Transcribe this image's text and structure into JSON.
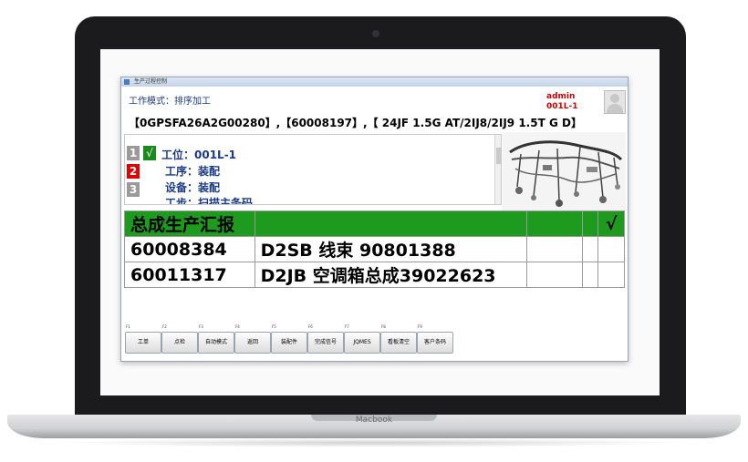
{
  "device": {
    "brand": "Macbook"
  },
  "window": {
    "title": "生产过程控制"
  },
  "header": {
    "mode": "工作模式：排序加工",
    "user": "admin",
    "station": "001L-1"
  },
  "order_line": "【0GPSFA26A2G00280】,【60008197】,【 24JF 1.5G AT/2IJ8/2IJ9 1.5T G D】",
  "steps": [
    {
      "num": "1",
      "color": "#9a9a9a"
    },
    {
      "num": "2",
      "color": "#e00000"
    },
    {
      "num": "3",
      "color": "#9a9a9a"
    }
  ],
  "check_mark": "√",
  "process": {
    "station_line": "工位：001L-1",
    "procedure_line": "工序：装配",
    "equipment_line": "设备：装配",
    "cut_line": "工步：扫描主条码"
  },
  "table": {
    "header": [
      "总成生产汇报",
      "",
      "",
      "",
      "√"
    ],
    "rows": [
      [
        "60008384",
        "D2SB 线束 90801388",
        "",
        "",
        ""
      ],
      [
        "60011317",
        "D2JB 空调箱总成39022623",
        "",
        "",
        ""
      ]
    ]
  },
  "fkeys": [
    {
      "key": "F1",
      "label": "工单"
    },
    {
      "key": "F2",
      "label": "点检"
    },
    {
      "key": "F3",
      "label": "自动模式"
    },
    {
      "key": "F4",
      "label": "返回"
    },
    {
      "key": "F5",
      "label": "装配件"
    },
    {
      "key": "F6",
      "label": "完成信号"
    },
    {
      "key": "F7",
      "label": "JQMES"
    },
    {
      "key": "F8",
      "label": "看板清空"
    },
    {
      "key": "F9",
      "label": "客户条码"
    }
  ],
  "colors": {
    "header_green": "#1e9a1e",
    "alert_red": "#e00000",
    "title_blue": "#1a3a8a"
  }
}
